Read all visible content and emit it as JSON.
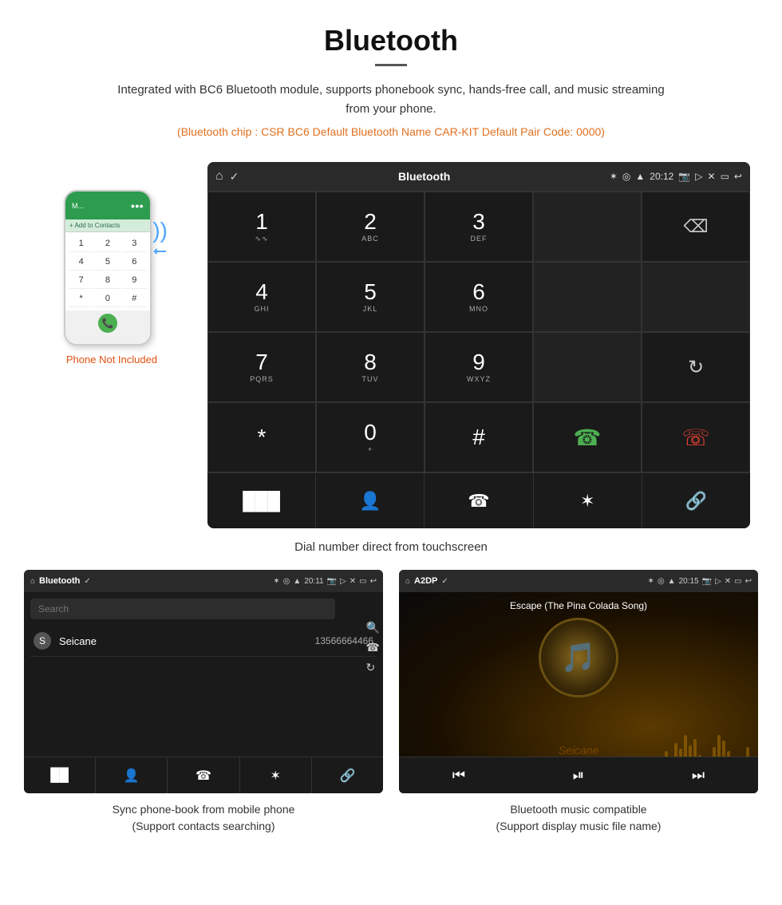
{
  "header": {
    "title": "Bluetooth",
    "description": "Integrated with BC6 Bluetooth module, supports phonebook sync, hands-free call, and music streaming from your phone.",
    "specs": "(Bluetooth chip : CSR BC6    Default Bluetooth Name CAR-KIT    Default Pair Code: 0000)"
  },
  "phone_note": "Phone Not Included",
  "car_screen": {
    "title": "Bluetooth",
    "time": "20:12",
    "dialpad": [
      {
        "number": "1",
        "letters": "∿∿"
      },
      {
        "number": "2",
        "letters": "ABC"
      },
      {
        "number": "3",
        "letters": "DEF"
      },
      {
        "number": "",
        "letters": ""
      },
      {
        "number": "⌫",
        "letters": ""
      },
      {
        "number": "4",
        "letters": "GHI"
      },
      {
        "number": "5",
        "letters": "JKL"
      },
      {
        "number": "6",
        "letters": "MNO"
      },
      {
        "number": "",
        "letters": ""
      },
      {
        "number": "",
        "letters": ""
      },
      {
        "number": "7",
        "letters": "PQRS"
      },
      {
        "number": "8",
        "letters": "TUV"
      },
      {
        "number": "9",
        "letters": "WXYZ"
      },
      {
        "number": "",
        "letters": ""
      },
      {
        "number": "↻",
        "letters": ""
      },
      {
        "number": "*",
        "letters": ""
      },
      {
        "number": "0",
        "letters": "+"
      },
      {
        "number": "#",
        "letters": ""
      },
      {
        "number": "📞",
        "letters": ""
      },
      {
        "number": "📵",
        "letters": ""
      }
    ]
  },
  "dial_caption": "Dial number direct from touchscreen",
  "phonebook_screen": {
    "title": "Bluetooth",
    "time": "20:11",
    "search_placeholder": "Search",
    "contacts": [
      {
        "letter": "S",
        "name": "Seicane",
        "number": "13566664466"
      }
    ]
  },
  "music_screen": {
    "title": "A2DP",
    "time": "20:15",
    "song_title": "Escape (The Pina Colada Song)"
  },
  "bottom_captions": {
    "phonebook": "Sync phone-book from mobile phone",
    "phonebook_sub": "(Support contacts searching)",
    "music": "Bluetooth music compatible",
    "music_sub": "(Support display music file name)"
  }
}
